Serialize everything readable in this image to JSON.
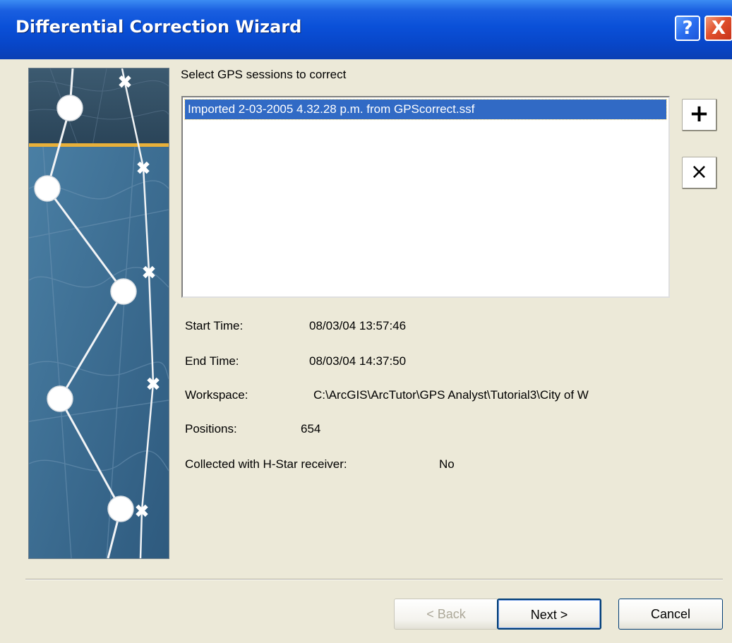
{
  "window": {
    "title": "Differential Correction Wizard",
    "help_glyph": "?",
    "close_glyph": "X"
  },
  "sessions": {
    "prompt": "Select GPS sessions to correct",
    "items": [
      "Imported 2-03-2005 4.32.28 p.m. from GPScorrect.ssf"
    ],
    "add_glyph": "+",
    "remove_glyph": "×"
  },
  "details": {
    "start_time_label": "Start Time:",
    "start_time_value": "08/03/04 13:57:46",
    "end_time_label": "End Time:",
    "end_time_value": "08/03/04 14:37:50",
    "workspace_label": "Workspace:",
    "workspace_value": "C:\\ArcGIS\\ArcTutor\\GPS Analyst\\Tutorial3\\City of W",
    "positions_label": "Positions:",
    "positions_value": "654",
    "hstar_label": "Collected with H-Star receiver:",
    "hstar_value": "No"
  },
  "buttons": {
    "back_label": "< Back",
    "next_label": "Next >",
    "cancel_label": "Cancel"
  },
  "colors": {
    "titlebar": "#0a50d8",
    "selection": "#316ac5",
    "dialog": "#ece9d8"
  }
}
